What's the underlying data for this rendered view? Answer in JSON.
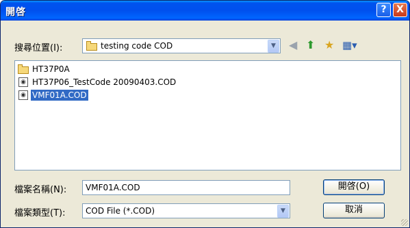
{
  "window": {
    "title": "開啓"
  },
  "lookin": {
    "label": "搜尋位置(I):",
    "value": "testing code COD"
  },
  "files": [
    {
      "name": "HT37P0A",
      "type": "folder",
      "selected": false
    },
    {
      "name": "HT37P06_TestCode 20090403.COD",
      "type": "cod-file",
      "selected": false
    },
    {
      "name": "VMF01A.COD",
      "type": "cod-file",
      "selected": true
    }
  ],
  "filename": {
    "label": "檔案名稱(N):",
    "value": "VMF01A.COD"
  },
  "filetype": {
    "label": "檔案類型(T):",
    "value": "COD File (*.COD)"
  },
  "buttons": {
    "open": "開啓(O)",
    "cancel": "取消",
    "help": "?",
    "close": "X"
  },
  "colors": {
    "title_bar": "#0054e3",
    "selection": "#316ac5",
    "dialog_bg": "#ece9d8"
  }
}
